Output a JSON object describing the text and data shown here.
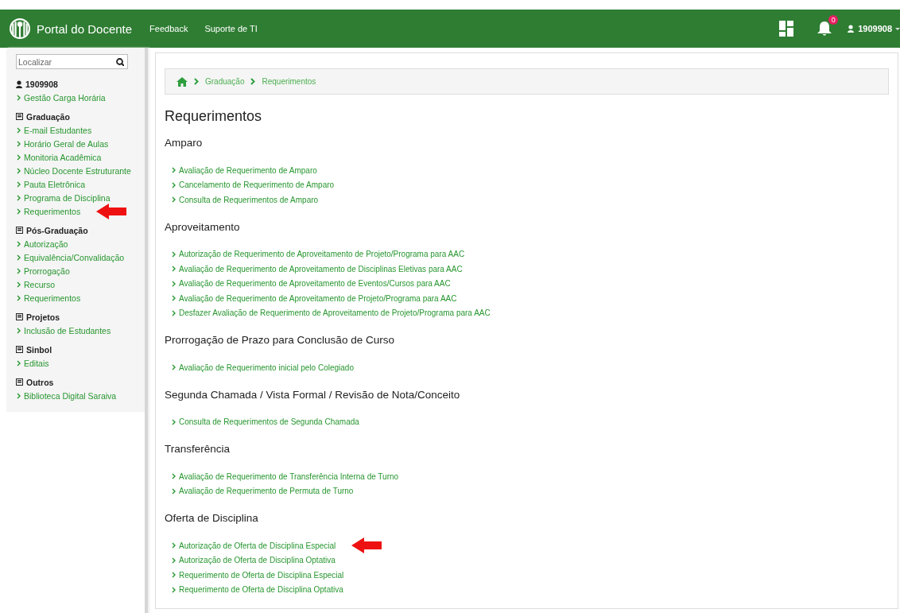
{
  "header": {
    "title": "Portal do Docente",
    "nav": [
      "Feedback",
      "Suporte de TI"
    ],
    "notification_count": "0",
    "user": "1909908"
  },
  "sidebar": {
    "search": {
      "placeholder": "Localizar"
    },
    "user": "1909908",
    "user_links": [
      {
        "label": "Gestão Carga Horária",
        "pointed": false
      }
    ],
    "groups": [
      {
        "title": "Graduação",
        "expanded": true,
        "items": [
          {
            "label": "E-mail Estudantes",
            "pointed": false
          },
          {
            "label": "Horário Geral de Aulas",
            "pointed": false
          },
          {
            "label": "Monitoria Acadêmica",
            "pointed": false
          },
          {
            "label": "Núcleo Docente Estruturante",
            "pointed": false
          },
          {
            "label": "Pauta Eletrônica",
            "pointed": false
          },
          {
            "label": "Programa de Disciplina",
            "pointed": false
          },
          {
            "label": "Requerimentos",
            "pointed": true
          }
        ]
      },
      {
        "title": "Pós-Graduação",
        "expanded": true,
        "items": [
          {
            "label": "Autorização",
            "pointed": false
          },
          {
            "label": "Equivalência/Convalidação",
            "pointed": false
          },
          {
            "label": "Prorrogação",
            "pointed": false
          },
          {
            "label": "Recurso",
            "pointed": false
          },
          {
            "label": "Requerimentos",
            "pointed": false
          }
        ]
      },
      {
        "title": "Projetos",
        "expanded": true,
        "items": [
          {
            "label": "Inclusão de Estudantes",
            "pointed": false
          }
        ]
      },
      {
        "title": "Sinbol",
        "expanded": true,
        "items": [
          {
            "label": "Editais",
            "pointed": false
          }
        ]
      },
      {
        "title": "Outros",
        "expanded": true,
        "items": [
          {
            "label": "Biblioteca Digital Saraiva",
            "pointed": false
          }
        ]
      }
    ]
  },
  "breadcrumb": [
    "Graduação",
    "Requerimentos"
  ],
  "page_title": "Requerimentos",
  "sections": [
    {
      "title": "Amparo",
      "links": [
        {
          "label": "Avaliação de Requerimento de Amparo",
          "pointed": false
        },
        {
          "label": "Cancelamento de Requerimento de Amparo",
          "pointed": false
        },
        {
          "label": "Consulta de Requerimentos de Amparo",
          "pointed": false
        }
      ]
    },
    {
      "title": "Aproveitamento",
      "links": [
        {
          "label": "Autorização de Requerimento de Aproveitamento de Projeto/Programa para AAC",
          "pointed": false
        },
        {
          "label": "Avaliação de Requerimento de Aproveitamento de Disciplinas Eletivas para AAC",
          "pointed": false
        },
        {
          "label": "Avaliação de Requerimento de Aproveitamento de Eventos/Cursos para AAC",
          "pointed": false
        },
        {
          "label": "Avaliação de Requerimento de Aproveitamento de Projeto/Programa para AAC",
          "pointed": false
        },
        {
          "label": "Desfazer Avaliação de Requerimento de Aproveitamento de Projeto/Programa para AAC",
          "pointed": false
        }
      ]
    },
    {
      "title": "Prorrogação de Prazo para Conclusão de Curso",
      "links": [
        {
          "label": "Avaliação de Requerimento inicial pelo Colegiado",
          "pointed": false
        }
      ]
    },
    {
      "title": "Segunda Chamada / Vista Formal / Revisão de Nota/Conceito",
      "links": [
        {
          "label": "Consulta de Requerimentos de Segunda Chamada",
          "pointed": false
        }
      ]
    },
    {
      "title": "Transferência",
      "links": [
        {
          "label": "Avaliação de Requerimento de Transferência Interna de Turno",
          "pointed": false
        },
        {
          "label": "Avaliação de Requerimento de Permuta de Turno",
          "pointed": false
        }
      ]
    },
    {
      "title": "Oferta de Disciplina",
      "links": [
        {
          "label": "Autorização de Oferta de Disciplina Especial",
          "pointed": true
        },
        {
          "label": "Autorização de Oferta de Disciplina Optativa",
          "pointed": false
        },
        {
          "label": "Requerimento de Oferta de Disciplina Especial",
          "pointed": false
        },
        {
          "label": "Requerimento de Oferta de Disciplina Optativa",
          "pointed": false
        }
      ]
    }
  ]
}
